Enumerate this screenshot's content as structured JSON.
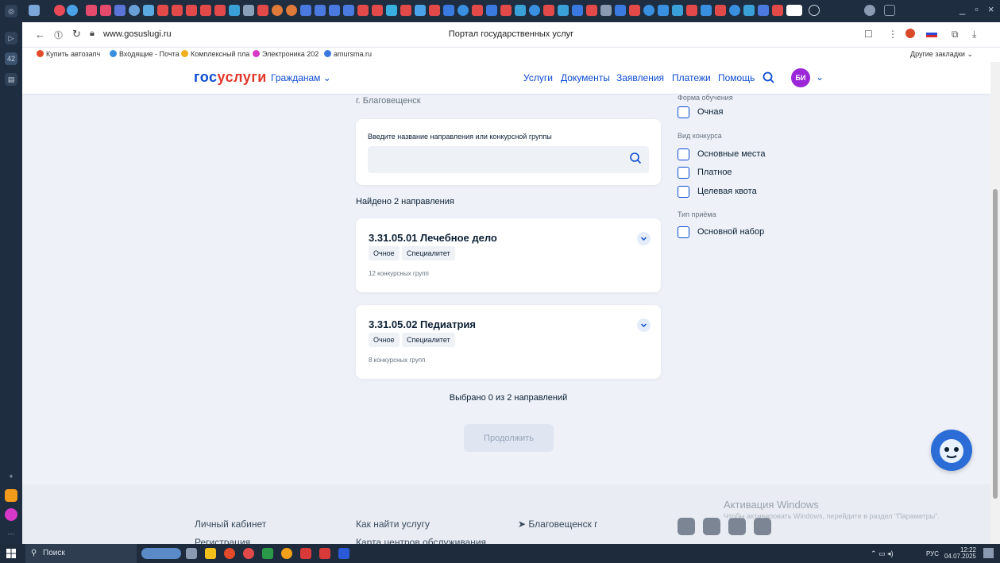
{
  "browser": {
    "url": "www.gosuslugi.ru",
    "page_title": "Портал государственных услуг",
    "tab_badge": "42",
    "bookmarks": [
      "Купить автозапч",
      "Входящие - Почта",
      "Комплексный пла",
      "Электроника 202",
      "amursma.ru"
    ],
    "other_bookmarks": "Другие закладки"
  },
  "header": {
    "logo_part1": "гос",
    "logo_part2": "услуги",
    "citizens": "Гражданам",
    "nav": [
      "Услуги",
      "Документы",
      "Заявления",
      "Платежи",
      "Помощь"
    ],
    "avatar_initials": "БИ"
  },
  "main": {
    "city": "г. Благовещенск",
    "search_label": "Введите название направления или конкурсной группы",
    "search_value": "",
    "found_text": "Найдено 2 направления",
    "directions": [
      {
        "title": "3.31.05.01 Лечебное дело",
        "tags": [
          "Очное",
          "Специалитет"
        ],
        "groups": "12 конкурсных групп"
      },
      {
        "title": "3.31.05.02 Педиатрия",
        "tags": [
          "Очное",
          "Специалитет"
        ],
        "groups": "8 конкурсных групп"
      }
    ],
    "selected_text": "Выбрано 0 из 2 направлений",
    "continue_label": "Продолжить"
  },
  "filters": {
    "form_heading": "Форма обучения",
    "form_options": [
      "Очная"
    ],
    "contest_heading": "Вид конкурса",
    "contest_options": [
      "Основные места",
      "Платное",
      "Целевая квота"
    ],
    "admission_heading": "Тип приёма",
    "admission_options": [
      "Основной набор"
    ]
  },
  "footer": {
    "col1": [
      "Личный кабинет",
      "Регистрация"
    ],
    "col2": [
      "Как найти услугу",
      "Карта центров обслуживания"
    ],
    "location": "Благовещенск г",
    "win_activation": "Активация Windows",
    "win_hint": "Чтобы активировать Windows, перейдите в раздел \"Параметры\"."
  },
  "taskbar": {
    "search": "Поиск",
    "lang": "РУС",
    "time": "12:22",
    "date": "04.07.2025"
  },
  "colors": {
    "brand_blue": "#0d4cd3",
    "brand_red": "#e3372b",
    "avatar": "#9b27d8"
  }
}
